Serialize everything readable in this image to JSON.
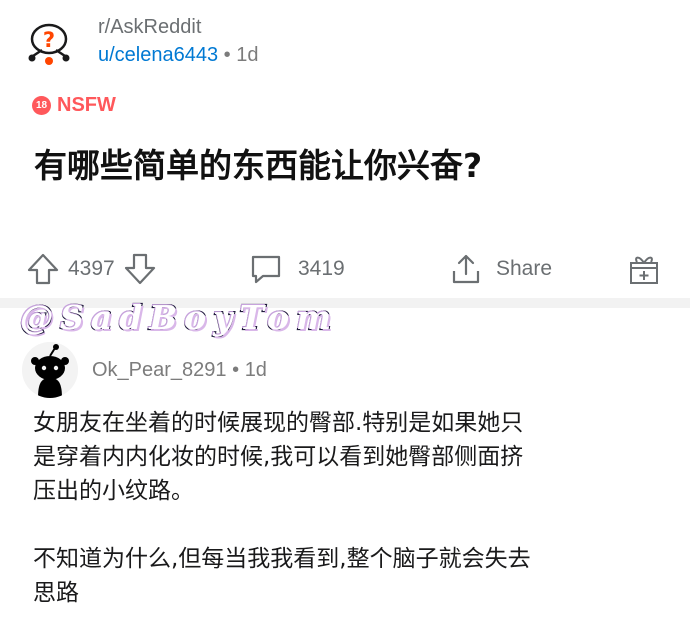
{
  "post": {
    "subreddit": "r/AskReddit",
    "author": "u/celena6443",
    "separator": "•",
    "age": "1d",
    "nsfw_badge": "18",
    "nsfw_label": "NSFW",
    "title": "有哪些简单的东西能让你兴奋?"
  },
  "actions": {
    "votes": "4397",
    "comments": "3419",
    "share": "Share"
  },
  "watermark": "@SadBoyTom",
  "comment": {
    "author": "Ok_Pear_8291",
    "separator": "•",
    "age": "1d",
    "paragraphs": [
      "女朋友在坐着的时候展现的臀部.特别是如果她只\n是穿着内内化妆的时候,我可以看到她臀部侧面挤\n压出的小纹路。",
      "不知道为什么,但每当我我看到,整个脑子就会失去\n思路"
    ]
  },
  "colors": {
    "accent": "#0079d3",
    "nsfw": "#ff585b",
    "muted": "#6b6f72",
    "divider": "#f2f2f2"
  },
  "icons": {
    "subreddit_avatar": "askreddit-snoo-icon",
    "upvote": "upvote-arrow-icon",
    "downvote": "downvote-arrow-icon",
    "comments": "speech-bubble-icon",
    "share": "share-upload-icon",
    "award": "gift-box-icon",
    "comment_avatar": "default-snoo-avatar-icon"
  }
}
